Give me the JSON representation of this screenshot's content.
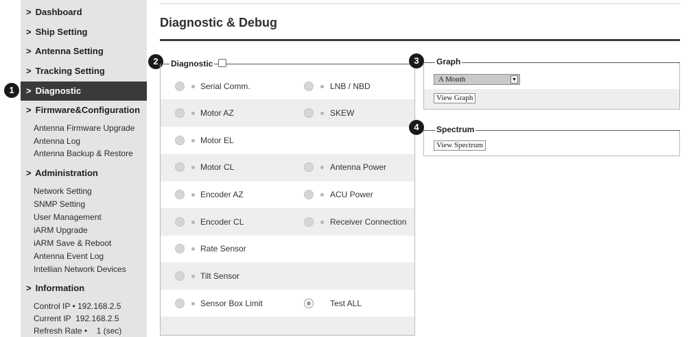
{
  "sidebar": {
    "items": [
      {
        "label": "Dashboard"
      },
      {
        "label": "Ship Setting"
      },
      {
        "label": "Antenna Setting"
      },
      {
        "label": "Tracking Setting"
      },
      {
        "label": "Diagnostic",
        "active": true
      },
      {
        "label": "Firmware&Configuration"
      },
      {
        "label": "Administration"
      },
      {
        "label": "Information"
      }
    ],
    "firmware_sub": [
      "Antenna Firmware Upgrade",
      "Antenna Log",
      "Antenna Backup & Restore"
    ],
    "admin_sub": [
      "Network Setting",
      "SNMP Setting",
      "User Management",
      "iARM Upgrade",
      "iARM Save & Reboot",
      "Antenna Event Log",
      "Intellian Network Devices"
    ],
    "info_lines": [
      "Control IP • 192.168.2.5",
      "Current IP  192.168.2.5",
      "Refresh Rate •    1 (sec)"
    ]
  },
  "page": {
    "title": "Diagnostic & Debug"
  },
  "callouts": [
    "1",
    "2",
    "3",
    "4"
  ],
  "diagnostic": {
    "label": "Diagnostic",
    "left_items": [
      "Serial Comm.",
      "Motor AZ",
      "Motor EL",
      "Motor CL",
      "Encoder AZ",
      "Encoder CL",
      "Rate Sensor",
      "Tilt Sensor",
      "Sensor Box Limit"
    ],
    "right_items": [
      "LNB / NBD",
      "SKEW",
      "",
      "Antenna Power",
      "ACU Power",
      "Receiver Connection",
      "",
      "",
      "Test ALL"
    ]
  },
  "graph": {
    "label": "Graph",
    "period_selected": "A Month",
    "view_button": "View Graph"
  },
  "spectrum": {
    "label": "Spectrum",
    "view_button": "View Spectrum"
  },
  "colors": {
    "sidebar_bg": "#e4e4e4",
    "active_bg": "#3a3a3a",
    "row_shade": "#eeeeee"
  }
}
